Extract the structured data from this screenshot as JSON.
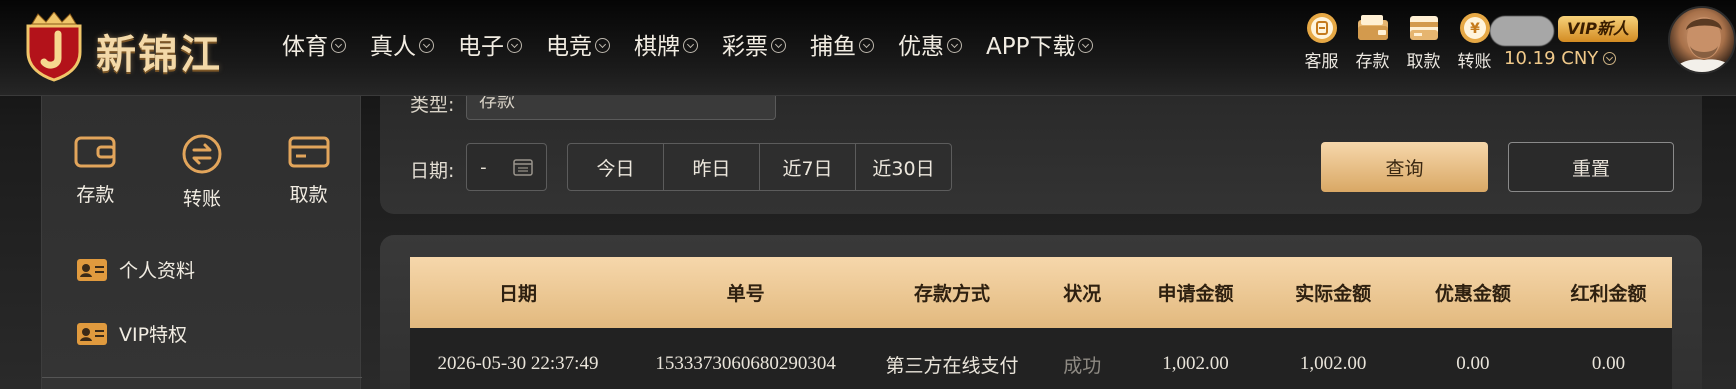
{
  "header": {
    "logo_text": "新锦江",
    "nav": [
      {
        "label": "体育"
      },
      {
        "label": "真人"
      },
      {
        "label": "电子"
      },
      {
        "label": "电竞"
      },
      {
        "label": "棋牌"
      },
      {
        "label": "彩票"
      },
      {
        "label": "捕鱼"
      },
      {
        "label": "优惠"
      },
      {
        "label": "APP下载"
      }
    ],
    "quick_links": [
      {
        "label": "客服",
        "icon": "customer-service-icon"
      },
      {
        "label": "存款",
        "icon": "deposit-wallet-icon"
      },
      {
        "label": "取款",
        "icon": "withdraw-card-icon"
      },
      {
        "label": "转账",
        "icon": "transfer-coin-icon"
      }
    ],
    "vip_badge": "VIP新人",
    "balance": "10.19 CNY"
  },
  "sidebar": {
    "actions": [
      {
        "label": "存款",
        "icon": "wallet-icon"
      },
      {
        "label": "转账",
        "icon": "transfer-icon"
      },
      {
        "label": "取款",
        "icon": "card-icon"
      }
    ],
    "menu": [
      {
        "label": "个人资料",
        "icon": "profile-card-icon"
      },
      {
        "label": "VIP特权",
        "icon": "vip-card-icon"
      }
    ]
  },
  "filter": {
    "type_label": "类型:",
    "type_value": "存款",
    "date_label": "日期:",
    "date_separator": "-",
    "quick_dates": [
      "今日",
      "昨日",
      "近7日",
      "近30日"
    ],
    "query_label": "查询",
    "reset_label": "重置"
  },
  "table": {
    "columns": [
      "日期",
      "单号",
      "存款方式",
      "状况",
      "申请金额",
      "实际金额",
      "优惠金额",
      "红利金额"
    ],
    "rows": [
      {
        "date": "2026-05-30 22:37:49",
        "order_no": "1533373060680290304",
        "method": "第三方在线支付",
        "status": "成功",
        "requested": "1,002.00",
        "actual": "1,002.00",
        "promo": "0.00",
        "bonus": "0.00"
      }
    ]
  },
  "colors": {
    "gold_light": "#f6d7ab",
    "gold_dark": "#d9a865",
    "panel_bg": "#303030",
    "row_bg": "#222222"
  }
}
